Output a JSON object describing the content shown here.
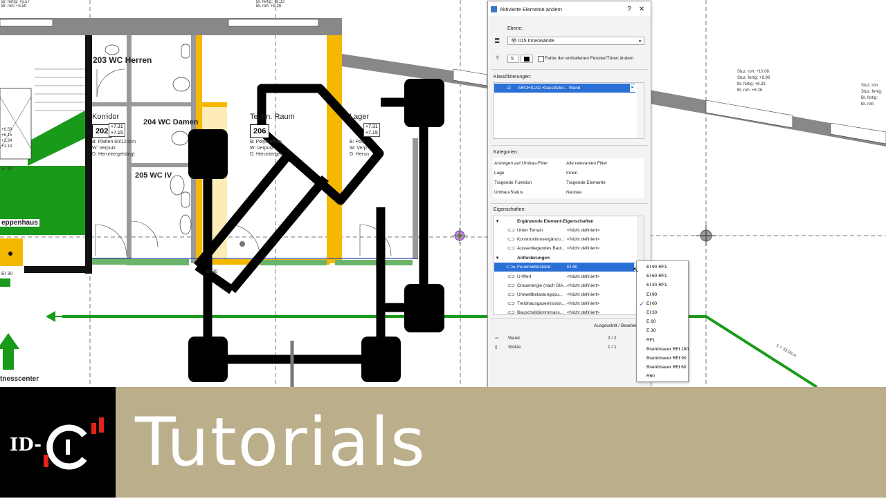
{
  "plan": {
    "rooms": {
      "r203": "203 WC Herren",
      "korridor": "Korridor",
      "r202_num": "202",
      "r202_lvl1": "+7.31",
      "r202_lvl2": "+7.15",
      "r202_b": "B: Platten 60/120cm",
      "r202_w": "W: Verputz",
      "r202_d": "D: Heruntergehängt",
      "r204": "204 WC Damen",
      "r205": "205 WC IV",
      "r206_name": "Techn. Raum",
      "r206_num": "206",
      "r206_b": "B: Polyurethan",
      "r206_w": "W: Verputz",
      "r206_d": "D: Heruntergeh.",
      "lager": "Lager",
      "lager_lvl1": "+7.31",
      "lager_lvl2": "+7.15",
      "lager_b": "B: Poly",
      "lager_w": "W: Verp",
      "lager_d": "D: Herun",
      "treppenhaus": "eppenhaus",
      "fitness": "tnesscenter"
    },
    "labels": {
      "ei30_a": "EI 30",
      "ei30_b": "EI 30",
      "ei30_c": "EI 30",
      "stair_1": "+6.59",
      "stair_2": "+6.15",
      "stair_3": "+1.34",
      "stair_4": "+1.14",
      "top_l1": "Br. fertig:  +6.57",
      "top_l2": "Br. roh:     +6.50",
      "top_m1": "Br. fertig:  +8.33",
      "top_m2": "Br. roh:     +8.26",
      "right_a1": "Stuz. roh:   +10.08",
      "right_a2": "Stuz. fertig: +9.99",
      "right_a3": "Br. fertig:   +8.33",
      "right_a4": "Br. roh:       +8.26",
      "right_b1": "Stuz. roh:",
      "right_b2": "Stuz. fertig:",
      "right_b3": "Br. fertig:",
      "right_b4": "Br. roh:",
      "dim": "L = 33.00 m"
    }
  },
  "dialog": {
    "title": "Aktivierte Elemente ändern",
    "help": "?",
    "close": "✕",
    "ebene_label": "Ebene:",
    "ebene_value": "015 Innenwände",
    "pen_value": "5",
    "checkbox_label": "Farbe der enthaltenen Fenster/Türen ändern",
    "klass_label": "Klassifizierungen:",
    "klass_item": "ARCHICAD Klassifizier...  Wand",
    "kat_label": "Kategorien:",
    "kategorien": [
      {
        "k": "Anzeigen auf Umbau-Filter",
        "v": "Alle relevanten Filter"
      },
      {
        "k": "Lage",
        "v": "Innen"
      },
      {
        "k": "Tragende Funktion",
        "v": "Tragende Elemente"
      },
      {
        "k": "Umbau-Status",
        "v": "Neubau"
      }
    ],
    "eig_label": "Eigenschaften:",
    "group1": "Ergänzende Element-Eigenschaften",
    "group1_rows": [
      {
        "k": "Unter Terrain",
        "v": "<Nicht definiert>"
      },
      {
        "k": "Konstruktionsergänzu...",
        "v": "<Nicht definiert>"
      },
      {
        "k": "Aussenliegendes Baut...",
        "v": "<Nicht definiert>"
      }
    ],
    "group2": "Anforderungen",
    "selected_key": "Feuerwiderstand",
    "selected_val": "EI 60",
    "group2_rows": [
      {
        "k": "U-Wert",
        "v": "<Nicht definiert>"
      },
      {
        "k": "Grauenergie (nach SIA...",
        "v": "<Nicht definiert>"
      },
      {
        "k": "Umweltbelastungspu...",
        "v": "<Nicht definiert>"
      },
      {
        "k": "Treibhausgasemission...",
        "v": "<Nicht definiert>"
      },
      {
        "k": "Bauschalldämmmass...",
        "v": "<Nicht definiert>"
      }
    ],
    "footer_header": "Ausgewählt / Bearbeit",
    "footer_rows": [
      {
        "k": "Wand",
        "v": "2  /  2"
      },
      {
        "k": "Stütze",
        "v": "1  /  1"
      }
    ]
  },
  "popup": {
    "options": [
      "EI 90-RF1",
      "EI 60-RF1",
      "EI 30-RF1",
      "EI 90",
      "EI 60",
      "EI 30",
      "E 60",
      "E 30",
      "RF1",
      "Brandmauer REI 180",
      "Brandmauer REI 90",
      "Brandmauer REI 60",
      "R60"
    ],
    "checked": "EI 60"
  },
  "banner": {
    "logo_text": "ID-C",
    "title": "Tutorials"
  },
  "colors": {
    "wall_yellow": "#f5b800",
    "stair_green": "#1a9a1a",
    "selection_blue": "#2a6fd6",
    "banner_tan": "#bbae8a"
  }
}
